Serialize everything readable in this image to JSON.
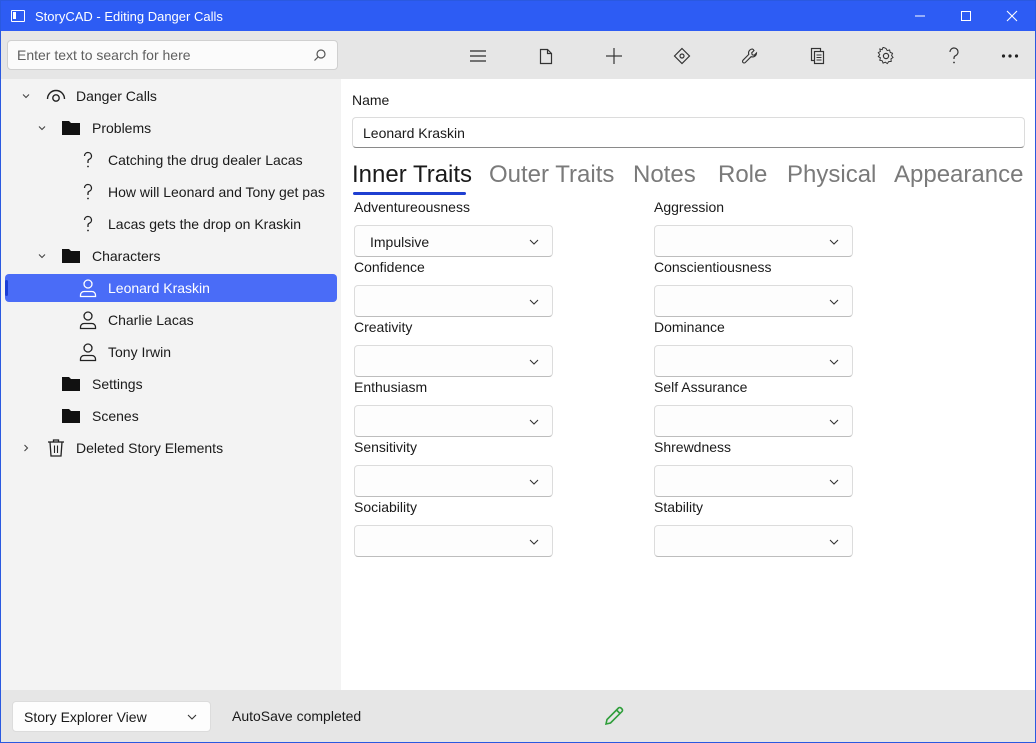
{
  "window": {
    "title": "StoryCAD - Editing Danger Calls",
    "controls": [
      "minimize-icon",
      "maximize-icon",
      "close-icon"
    ]
  },
  "toolbar": {
    "search_placeholder": "Enter text to search for here",
    "icons": [
      "hamburger-menu-icon",
      "new-file-icon",
      "add-icon",
      "navigation-icon",
      "tools-wrench-icon",
      "reports-icon",
      "settings-gear-icon",
      "help-icon",
      "more-icon"
    ]
  },
  "tree": {
    "root": "Danger Calls",
    "problems": "Problems",
    "problem_items": [
      "Catching the drug dealer Lacas",
      "How will Leonard and Tony get pas",
      "Lacas gets the drop on Kraskin"
    ],
    "characters": "Characters",
    "character_items": [
      "Leonard Kraskin",
      "Charlie Lacas",
      "Tony Irwin"
    ],
    "settings": "Settings",
    "scenes": "Scenes",
    "deleted": "Deleted Story Elements",
    "selected": "Leonard Kraskin"
  },
  "editor": {
    "name_label": "Name",
    "name_value": "Leonard Kraskin",
    "tabs": [
      "Inner Traits",
      "Outer Traits",
      "Notes",
      "Role",
      "Physical",
      "Appearance"
    ],
    "active_tab": "Inner Traits",
    "left_fields": [
      {
        "label": "Adventureousness",
        "value": "Impulsive"
      },
      {
        "label": "Confidence",
        "value": ""
      },
      {
        "label": "Creativity",
        "value": ""
      },
      {
        "label": "Enthusiasm",
        "value": ""
      },
      {
        "label": "Sensitivity",
        "value": ""
      },
      {
        "label": "Sociability",
        "value": ""
      }
    ],
    "right_fields": [
      {
        "label": "Aggression",
        "value": ""
      },
      {
        "label": "Conscientiousness",
        "value": ""
      },
      {
        "label": "Dominance",
        "value": ""
      },
      {
        "label": "Self Assurance",
        "value": ""
      },
      {
        "label": "Shrewdness",
        "value": ""
      },
      {
        "label": "Stability",
        "value": ""
      }
    ]
  },
  "statusbar": {
    "view_selector": "Story Explorer View",
    "status": "AutoSave completed",
    "edit_icon_color": "#2e9e3a"
  },
  "colors": {
    "titlebar": "#2d5cf4",
    "selection": "#4a6cf7",
    "tab_underline": "#1f3fd1"
  }
}
